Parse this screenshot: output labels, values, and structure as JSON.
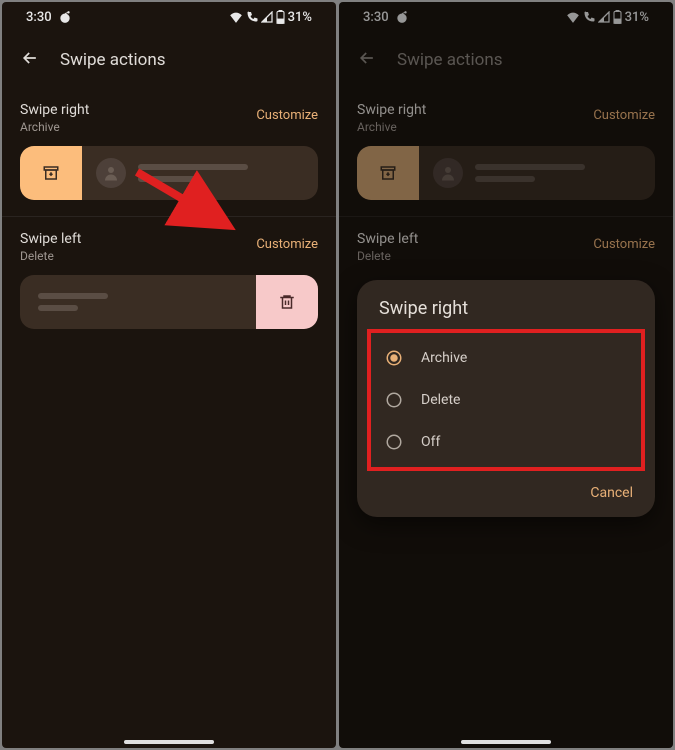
{
  "status": {
    "time": "3:30",
    "battery": "31%"
  },
  "header": {
    "title": "Swipe actions"
  },
  "swipe_right": {
    "title": "Swipe right",
    "action": "Archive",
    "customize": "Customize"
  },
  "swipe_left": {
    "title": "Swipe left",
    "action": "Delete",
    "customize": "Customize"
  },
  "dialog": {
    "title": "Swipe right",
    "options": [
      "Archive",
      "Delete",
      "Off"
    ],
    "selected": "Archive",
    "cancel": "Cancel"
  }
}
